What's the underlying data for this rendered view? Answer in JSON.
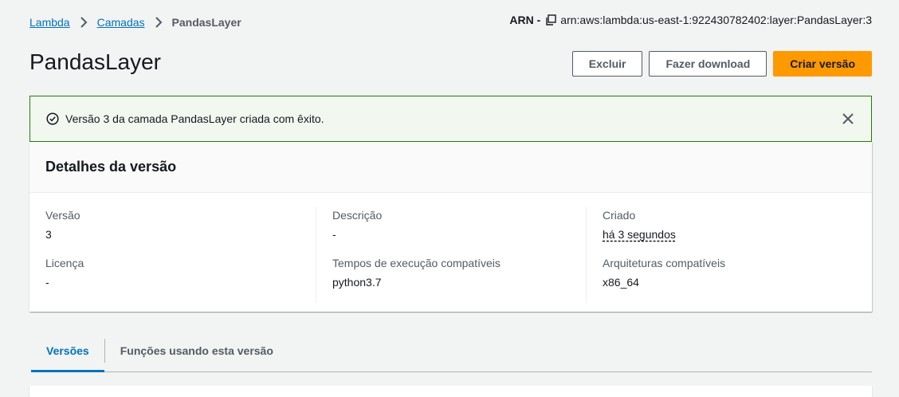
{
  "breadcrumb": {
    "items": [
      "Lambda",
      "Camadas"
    ],
    "current": "PandasLayer"
  },
  "arn": {
    "label": "ARN -",
    "value": "arn:aws:lambda:us-east-1:922430782402:layer:PandasLayer:3"
  },
  "page": {
    "title": "PandasLayer"
  },
  "actions": {
    "delete": "Excluir",
    "download": "Fazer download",
    "create": "Criar versão"
  },
  "flash": {
    "message": "Versão 3 da camada PandasLayer criada com êxito.",
    "color": "#1d8102"
  },
  "details": {
    "header": "Detalhes da versão",
    "fields": [
      {
        "label": "Versão",
        "value": "3"
      },
      {
        "label": "Descrição",
        "value": "-"
      },
      {
        "label": "Criado",
        "value": "há 3 segundos"
      },
      {
        "label": "Licença",
        "value": "-"
      },
      {
        "label": "Tempos de execução compatíveis",
        "value": "python3.7"
      },
      {
        "label": "Arquiteturas compatíveis",
        "value": "x86_64"
      }
    ]
  },
  "tabs": [
    {
      "label": "Versões"
    },
    {
      "label": "Funções usando esta versão"
    }
  ],
  "colors": {
    "link": "#0073bb",
    "primary": "#ff9900",
    "success": "#1d8102"
  }
}
